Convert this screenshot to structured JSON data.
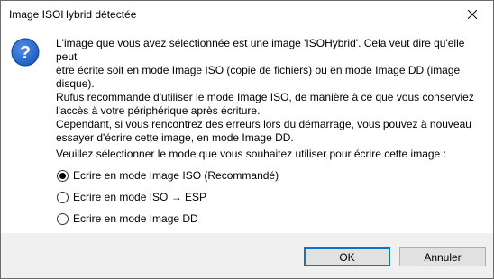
{
  "dialog": {
    "title": "Image ISOHybrid détectée",
    "icon": "question-icon",
    "message_lines": [
      "L'image que vous avez sélectionnée est une image 'ISOHybrid'. Cela veut dire qu'elle peut",
      "être écrite soit en mode Image ISO (copie de fichiers) ou en mode Image DD (image",
      "disque).",
      "Rufus recommande d'utiliser le mode Image ISO, de manière à ce que vous conserviez",
      "l'accès à votre périphérique après écriture.",
      "Cependant, si vous rencontrez des erreurs lors du démarrage, vous pouvez à nouveau",
      "essayer d'écrire cette image, en mode Image DD."
    ],
    "prompt": "Veuillez sélectionner le mode que vous souhaitez utiliser pour écrire cette image :",
    "options": [
      {
        "label": "Ecrire en mode Image ISO (Recommandé)",
        "checked": true
      },
      {
        "label": "Ecrire en mode ISO → ESP",
        "checked": false
      },
      {
        "label": "Ecrire en mode Image DD",
        "checked": false
      }
    ],
    "buttons": {
      "ok": "OK",
      "cancel": "Annuler"
    },
    "colors": {
      "accent": "#0078d7",
      "icon_blue": "#1f5fbf",
      "footer": "#f0f0f0"
    }
  }
}
